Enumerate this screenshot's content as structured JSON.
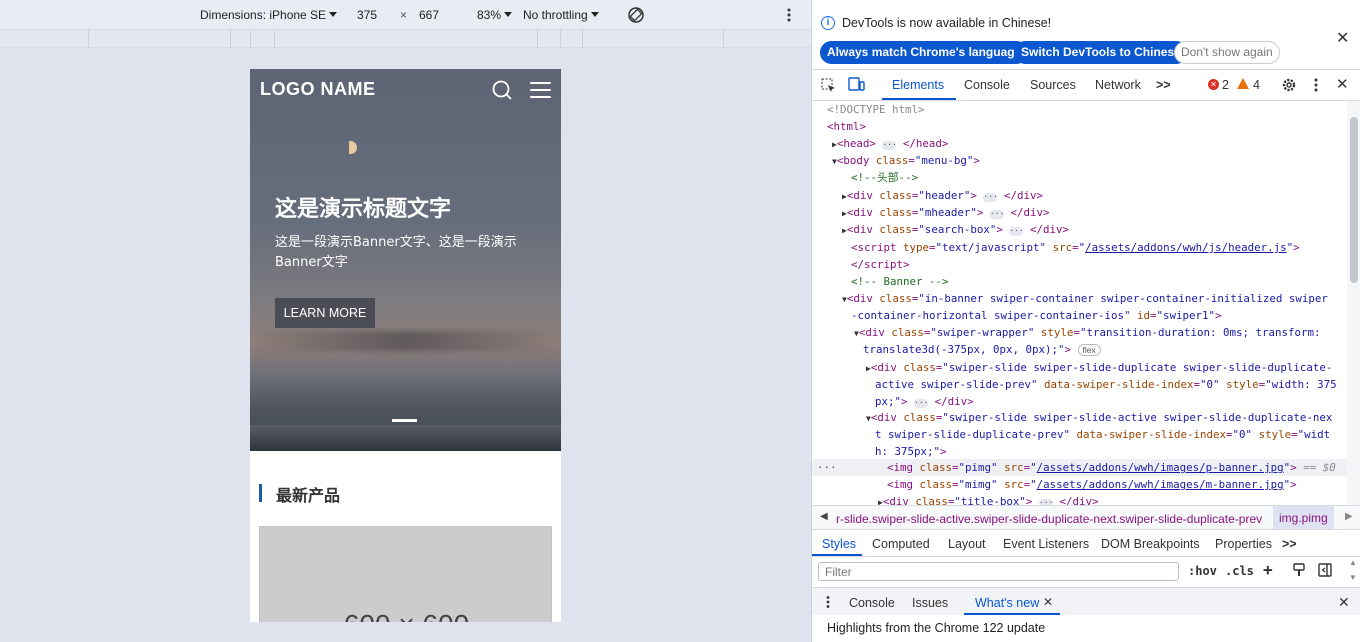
{
  "toolbar": {
    "device": "Dimensions: iPhone SE",
    "width": "375",
    "times": "×",
    "height": "667",
    "zoom": "83%",
    "throttling": "No throttling"
  },
  "site": {
    "logo": "LOGO NAME",
    "banner_title": "这是演示标题文字",
    "banner_subtitle": "这是一段演示Banner文字、这是一段演示Banner文字",
    "learn_more": "LEARN MORE",
    "section_title": "最新产品",
    "placeholder": "600 × 600"
  },
  "devtools": {
    "notice": "DevTools is now available in Chinese!",
    "btn_match": "Always match Chrome's language",
    "btn_switch": "Switch DevTools to Chinese",
    "btn_dont": "Don't show again",
    "tabs": [
      "Elements",
      "Console",
      "Sources",
      "Network"
    ],
    "more": ">>",
    "errors": "2",
    "warnings": "4",
    "breadcrumb": "r-slide.swiper-slide-active.swiper-slide-duplicate-next.swiper-slide-duplicate-prev",
    "breadcrumb_last": "img.pimg",
    "style_tabs": [
      "Styles",
      "Computed",
      "Layout",
      "Event Listeners",
      "DOM Breakpoints",
      "Properties"
    ],
    "filter_placeholder": "Filter",
    "hov": ":hov",
    "cls": ".cls",
    "drawer_tabs": [
      "Console",
      "Issues",
      "What's new"
    ],
    "highlights": "Highlights from the Chrome 122 update",
    "code": {
      "l1": "<!DOCTYPE html>",
      "l2": "<html>",
      "comment_head": "<!--头部-->",
      "comment_banner": "<!-- Banner -->",
      "header_js": "/assets/addons/wwh/js/header.js",
      "pbanner": "/assets/addons/wwh/images/p-banner.jpg",
      "mbanner": "/assets/addons/wwh/images/m-banner.jpg",
      "eq": "== $0",
      "flex": "flex"
    }
  }
}
